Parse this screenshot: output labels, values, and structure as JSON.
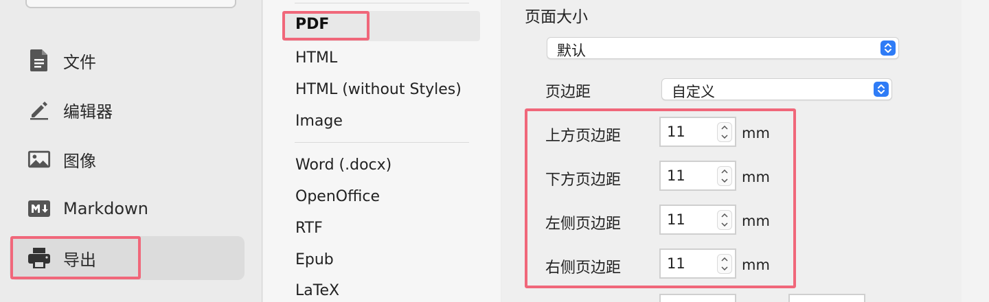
{
  "sidebar": {
    "items": [
      {
        "label": "文件",
        "icon": "document-icon"
      },
      {
        "label": "编辑器",
        "icon": "pencil-icon"
      },
      {
        "label": "图像",
        "icon": "image-icon"
      },
      {
        "label": "Markdown",
        "icon": "markdown-icon"
      },
      {
        "label": "导出",
        "icon": "printer-icon",
        "active": true
      }
    ]
  },
  "formats": {
    "selected": "PDF",
    "group1": [
      "HTML",
      "HTML (without Styles)",
      "Image"
    ],
    "group2": [
      "Word (.docx)",
      "OpenOffice",
      "RTF",
      "Epub",
      "LaTeX"
    ]
  },
  "settings": {
    "page_size_title": "页面大小",
    "page_size_value": "默认",
    "margin_label": "页边距",
    "margin_value": "自定义",
    "margins": [
      {
        "label": "上方页边距",
        "value": "11",
        "unit": "mm"
      },
      {
        "label": "下方页边距",
        "value": "11",
        "unit": "mm"
      },
      {
        "label": "左侧页边距",
        "value": "11",
        "unit": "mm"
      },
      {
        "label": "右侧页边距",
        "value": "11",
        "unit": "mm"
      }
    ]
  },
  "colors": {
    "highlight": "#f0677a",
    "accent": "#2f7cf6"
  }
}
